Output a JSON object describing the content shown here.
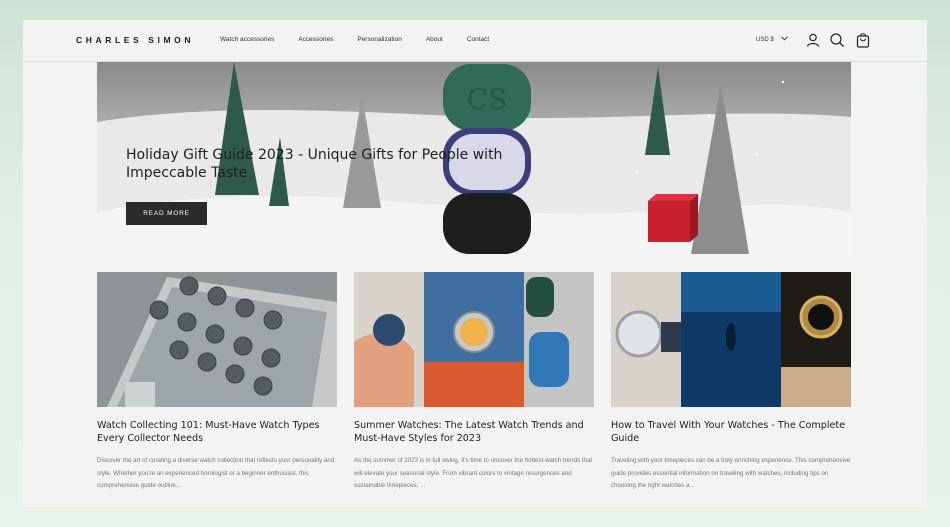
{
  "header": {
    "logo": "CHARLES SIMON",
    "nav": [
      "Watch accessories",
      "Accessories",
      "Personalization",
      "About",
      "Contact"
    ],
    "currency": "USD $"
  },
  "icons": {
    "account": "user-icon",
    "search": "search-icon",
    "cart": "shopping-bag-icon",
    "currency_toggle": "chevron-down-icon"
  },
  "hero": {
    "title": "Holiday Gift Guide 2023 - Unique Gifts for People with Impeccable Taste",
    "button": "READ MORE",
    "box_monogram": "CS"
  },
  "articles": [
    {
      "title": "Watch Collecting 101: Must-Have Watch Types Every Collector Needs",
      "excerpt": "Discover the art of curating a diverse watch collection that reflects your personality and style. Whether you're an experienced horologist or a beginner enthusiast, this comprehensive guide outline..."
    },
    {
      "title": "Summer Watches: The Latest Watch Trends and Must-Have Styles for 2023",
      "excerpt": "As the summer of 2023 is in full swing, it's time to uncover the hottest watch trends that will elevate your seasonal style. From vibrant colors to vintage resurgences and sustainable timepieces, ..."
    },
    {
      "title": "How to Travel With Your Watches - The Complete Guide",
      "excerpt": "Traveling with your timepieces can be a truly enriching experience. This comprehensive guide provides essential information on traveling with watches, including tips on choosing the right watches a..."
    }
  ],
  "colors": {
    "accent_green": "#2f5f50",
    "button_dark": "#2a2a2a",
    "page_bg": "#f3f3f3"
  }
}
